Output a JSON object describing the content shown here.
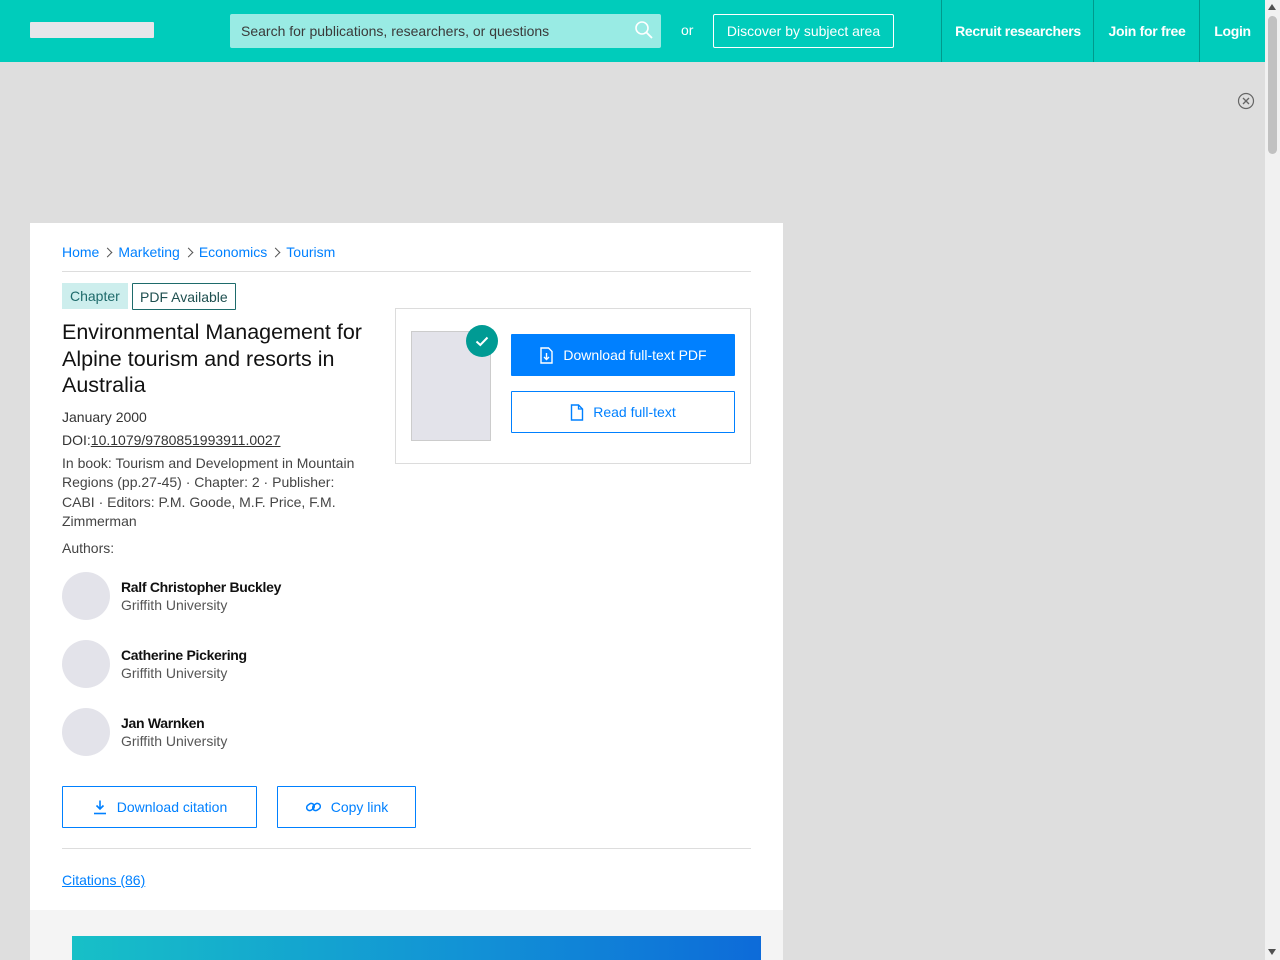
{
  "header": {
    "search_placeholder": "Search for publications, researchers, or questions",
    "or_label": "or",
    "discover_label": "Discover by subject area",
    "nav": {
      "recruit": "Recruit researchers",
      "join": "Join for free",
      "login": "Login"
    },
    "bg_color": "#00ccbb"
  },
  "breadcrumb": [
    "Home",
    "Marketing",
    "Economics",
    "Tourism"
  ],
  "tags": {
    "type": "Chapter",
    "pdf": "PDF Available"
  },
  "publication": {
    "title": "Environmental Management for Alpine tourism and resorts in Australia",
    "date": "January 2000",
    "doi_prefix": "DOI:",
    "doi": "10.1079/9780851993911.0027",
    "book_info": "In book: Tourism and Development in Mountain Regions (pp.27-45) · Chapter: 2 · Publisher: CABI · Editors: P.M. Goode, M.F. Price, F.M. Zimmerman",
    "authors_heading": "Authors:",
    "authors": [
      {
        "name": "Ralf Christopher Buckley",
        "affiliation": "Griffith University"
      },
      {
        "name": "Catherine Pickering",
        "affiliation": "Griffith University"
      },
      {
        "name": "Jan Warnken",
        "affiliation": "Griffith University"
      }
    ]
  },
  "actions": {
    "download_pdf": "Download full-text PDF",
    "read_full": "Read full-text",
    "download_citation": "Download citation",
    "copy_link": "Copy link",
    "citations": "Citations (86)"
  },
  "colors": {
    "accent": "#0080ff",
    "check": "#009b94",
    "tag_bg": "#cdeeed"
  },
  "icons": [
    "search-icon",
    "close-circle-icon",
    "chevron-right-icon",
    "check-icon",
    "pdf-download-icon",
    "document-icon",
    "download-icon",
    "link-icon"
  ]
}
